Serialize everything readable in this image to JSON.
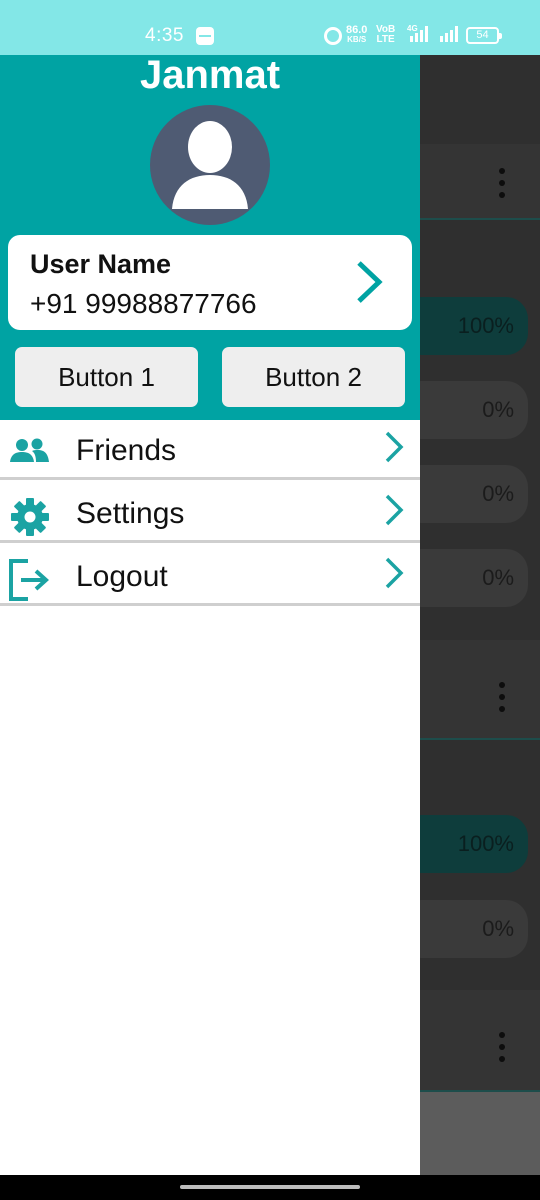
{
  "status_bar": {
    "time": "4:35",
    "net_speed_value": "86.0",
    "net_speed_unit": "KB/S",
    "volte_top": "VoB",
    "volte_bottom": "LTE",
    "network_type": "4G",
    "battery": "54"
  },
  "drawer": {
    "app_title": "Janmat",
    "user": {
      "name": "User Name",
      "phone": "+91 99988877766"
    },
    "buttons": {
      "button1": "Button 1",
      "button2": "Button 2"
    },
    "menu": [
      {
        "label": "Friends",
        "icon": "friends-icon"
      },
      {
        "label": "Settings",
        "icon": "gear-icon"
      },
      {
        "label": "Logout",
        "icon": "logout-icon"
      }
    ]
  },
  "background": {
    "pills": [
      "100%",
      "0%",
      "0%",
      "0%",
      "100%",
      "0%"
    ]
  },
  "colors": {
    "accent": "#00a3a3",
    "status_bar": "#83e7e7",
    "avatar_bg": "#4f5b73"
  }
}
